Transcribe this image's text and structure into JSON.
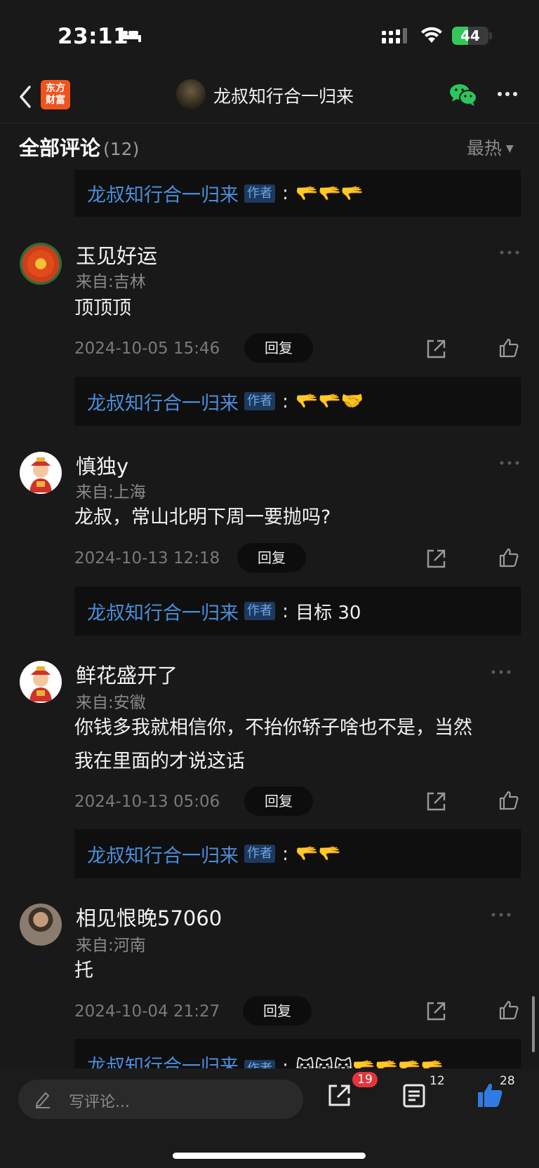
{
  "status": {
    "time": "23:11",
    "battery": "44",
    "battery_level": 0.44
  },
  "nav": {
    "logo_line1": "东方",
    "logo_line2": "财富",
    "title": "龙叔知行合一归来"
  },
  "comments_header": {
    "title": "全部评论",
    "count": "(12)",
    "sort": "最热"
  },
  "author_badge": "作者",
  "reply_button": "回复",
  "comments": [
    {
      "reply": {
        "name": "龙叔知行合一归来",
        "text": "🫳🫳🫳"
      }
    },
    {
      "name": "玉见好运",
      "origin": "来自:吉林",
      "text": "顶顶顶",
      "date": "2024-10-05 15:46",
      "reply": {
        "name": "龙叔知行合一归来",
        "text": "🫳🫳🤝"
      }
    },
    {
      "name": "慎独y",
      "origin": "来自:上海",
      "text": "龙叔，常山北明下周一要抛吗?",
      "date": "2024-10-13 12:18",
      "reply": {
        "name": "龙叔知行合一归来",
        "text": "目标 30"
      }
    },
    {
      "name": "鲜花盛开了",
      "origin": "来自:安徽",
      "text_line1": "你钱多我就相信你，不抬你轿子啥也不是，当然",
      "text_line2": "我在里面的才说这话",
      "date": "2024-10-13 05:06",
      "reply": {
        "name": "龙叔知行合一归来",
        "text": "🫳🫳"
      }
    },
    {
      "name": "相见恨晚57060",
      "origin": "来自:河南",
      "text": "托",
      "date": "2024-10-04 21:27",
      "reply": {
        "name": "龙叔知行合一归来",
        "text": "🐱🐱🐱🫳🫳🫳🫳"
      }
    }
  ],
  "bottom_bar": {
    "placeholder": "写评论...",
    "share_count": "19",
    "comment_count": "12",
    "like_count": "28"
  },
  "colors": {
    "link": "#4a8edb",
    "accent_like": "#2f7be3",
    "badge_red": "#e5343a",
    "battery": "#34c759"
  }
}
